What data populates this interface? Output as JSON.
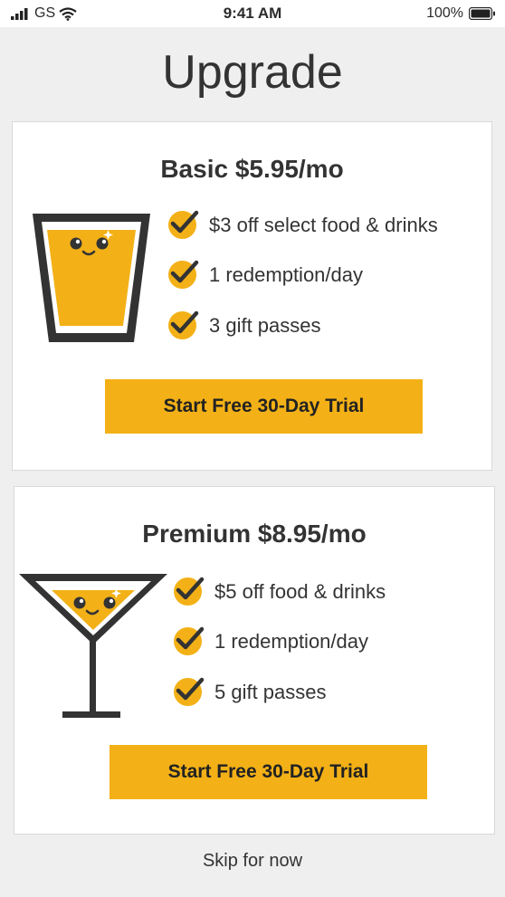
{
  "status_bar": {
    "carrier": "GS",
    "time": "9:41 AM",
    "battery": "100%"
  },
  "page": {
    "title": "Upgrade"
  },
  "plans": [
    {
      "title": "Basic $5.95/mo",
      "features": [
        "$3 off select food & drinks",
        "1 redemption/day",
        "3 gift passes"
      ],
      "cta_label": "Start Free 30-Day Trial",
      "icon": "pint-glass-icon"
    },
    {
      "title": "Premium $8.95/mo",
      "features": [
        "$5 off food & drinks",
        "1 redemption/day",
        "5 gift passes"
      ],
      "cta_label": "Start Free 30-Day Trial",
      "icon": "martini-glass-icon"
    }
  ],
  "footer": {
    "skip_label": "Skip for now"
  },
  "colors": {
    "accent": "#f3b117",
    "background": "#efefef",
    "card": "#ffffff",
    "text": "#333333"
  }
}
